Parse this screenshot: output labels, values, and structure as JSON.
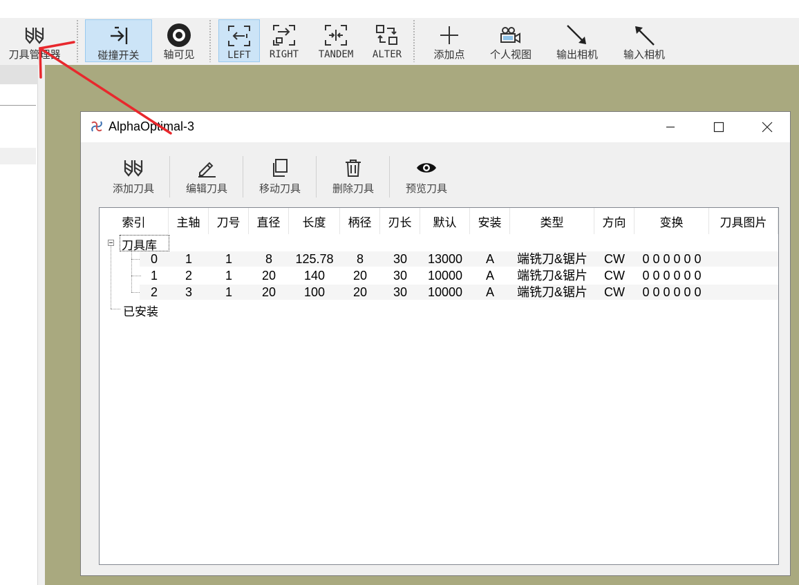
{
  "toolbar": {
    "items": [
      {
        "id": "tool-manager",
        "label": "刀具管理器",
        "icon": "end-mill-icon",
        "active": false
      },
      {
        "id": "collision",
        "label": "碰撞开关",
        "icon": "collision-stop-icon",
        "active": true
      },
      {
        "id": "axis-visible",
        "label": "轴可见",
        "icon": "eye-icon",
        "active": false
      },
      {
        "id": "left",
        "label": "LEFT",
        "icon": "view-left-icon",
        "active": true
      },
      {
        "id": "right",
        "label": "RIGHT",
        "icon": "view-right-icon",
        "active": false
      },
      {
        "id": "tandem",
        "label": "TANDEM",
        "icon": "view-tandem-icon",
        "active": false
      },
      {
        "id": "alter",
        "label": "ALTER",
        "icon": "view-alter-icon",
        "active": false
      },
      {
        "id": "add-point",
        "label": "添加点",
        "icon": "plus-icon",
        "active": false
      },
      {
        "id": "personal-view",
        "label": "个人视图",
        "icon": "camera-icon",
        "active": false
      },
      {
        "id": "export-camera",
        "label": "输出相机",
        "icon": "arrow-down-right-icon",
        "active": false
      },
      {
        "id": "import-camera",
        "label": "输入相机",
        "icon": "arrow-up-left-icon",
        "active": false
      }
    ]
  },
  "dialog": {
    "title": "AlphaOptimal-3",
    "buttons": [
      {
        "label": "添加刀具",
        "icon": "end-mill-icon"
      },
      {
        "label": "编辑刀具",
        "icon": "pencil-icon"
      },
      {
        "label": "移动刀具",
        "icon": "copy-icon"
      },
      {
        "label": "删除刀具",
        "icon": "trash-icon"
      },
      {
        "label": "预览刀具",
        "icon": "eye-icon"
      }
    ],
    "table": {
      "columns": [
        "索引",
        "主轴",
        "刀号",
        "直径",
        "长度",
        "柄径",
        "刃长",
        "默认",
        "安装",
        "类型",
        "方向",
        "变换",
        "刀具图片"
      ],
      "library_node": "刀具库",
      "installed_node": "已安装",
      "rows": [
        [
          "0",
          "1",
          "1",
          "8",
          "125.78",
          "8",
          "30",
          "13000",
          "A",
          "端铣刀&锯片",
          "CW",
          "0 0 0 0 0 0",
          ""
        ],
        [
          "1",
          "2",
          "1",
          "20",
          "140",
          "20",
          "30",
          "10000",
          "A",
          "端铣刀&锯片",
          "CW",
          "0 0 0 0 0 0",
          ""
        ],
        [
          "2",
          "3",
          "1",
          "20",
          "100",
          "20",
          "30",
          "10000",
          "A",
          "端铣刀&锯片",
          "CW",
          "0 0 0 0 0 0",
          ""
        ]
      ]
    }
  },
  "colors": {
    "workspace": "#a9a97f",
    "toolbar_bg": "#f0f0f0",
    "active_button": "#cce4f7",
    "annotation_red": "#e8282d"
  }
}
